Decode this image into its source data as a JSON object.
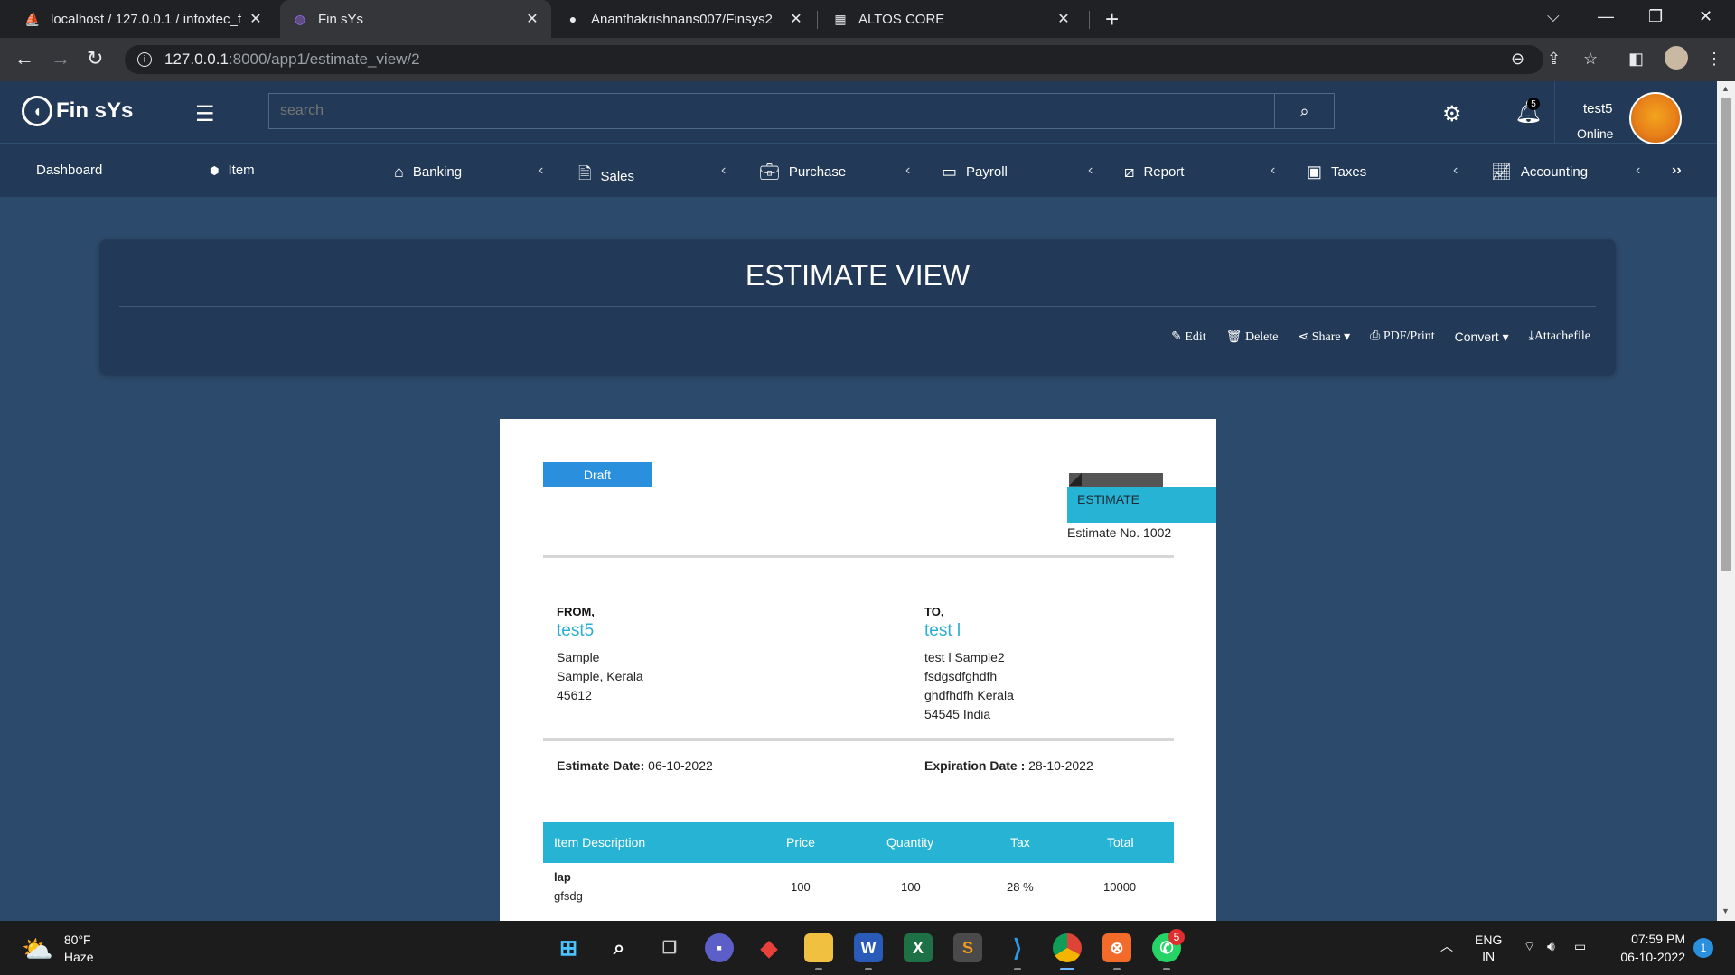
{
  "browser": {
    "tabs": [
      {
        "title": "localhost / 127.0.0.1 / infoxtec_fi",
        "icon": "phpmyadmin-icon"
      },
      {
        "title": "Fin sYs",
        "icon": "finsys-icon"
      },
      {
        "title": "Ananthakrishnans007/Finsys2",
        "icon": "github-icon"
      },
      {
        "title": "ALTOS CORE",
        "icon": "grid-icon"
      }
    ],
    "url_host": "127.0.0.1",
    "url_path": ":8000/app1/estimate_view/2"
  },
  "header": {
    "logo_text": "Fin sYs",
    "search_placeholder": "search",
    "notification_count": "5",
    "user_name": "test5",
    "user_status": "Online"
  },
  "nav": {
    "items": [
      "Dashboard",
      "Item",
      "Banking",
      "Sales",
      "Purchase",
      "Payroll",
      "Report",
      "Taxes",
      "Accounting"
    ]
  },
  "page": {
    "title": "ESTIMATE VIEW",
    "actions": {
      "edit": "Edit",
      "delete": "Delete",
      "share": "Share",
      "pdf": "PDF/Print",
      "convert": "Convert",
      "attach": "Attachefile"
    }
  },
  "estimate": {
    "status": "Draft",
    "ribbon": "ESTIMATE",
    "number": "Estimate No. 1002",
    "from_label": "FROM,",
    "from_name": "test5",
    "from_address": [
      "Sample",
      "Sample, Kerala",
      "45612"
    ],
    "to_label": "TO,",
    "to_name": "test l",
    "to_address": [
      "test l Sample2",
      "fsdgsdfghdfh",
      "ghdfhdfh Kerala",
      "54545 India"
    ],
    "date_label": "Estimate Date:",
    "date_value": "06-10-2022",
    "expiry_label": "Expiration Date :",
    "expiry_value": "28-10-2022",
    "table": {
      "headers": [
        "Item Description",
        "Price",
        "Quantity",
        "Tax",
        "Total"
      ],
      "rows": [
        {
          "item": "lap",
          "desc": "gfsdg",
          "price": "100",
          "qty": "100",
          "tax": "28 %",
          "total": "10000"
        }
      ]
    }
  },
  "taskbar": {
    "temp": "80°F",
    "weather": "Haze",
    "lang": "ENG",
    "region": "IN",
    "time": "07:59 PM",
    "date": "06-10-2022",
    "whatsapp_badge": "5",
    "notif_count": "1"
  },
  "colors": {
    "page_bg": "#2c4a6b",
    "header_bg": "#223a57",
    "accent_cyan": "#27b4d4",
    "draft_blue": "#2a8fdd"
  }
}
